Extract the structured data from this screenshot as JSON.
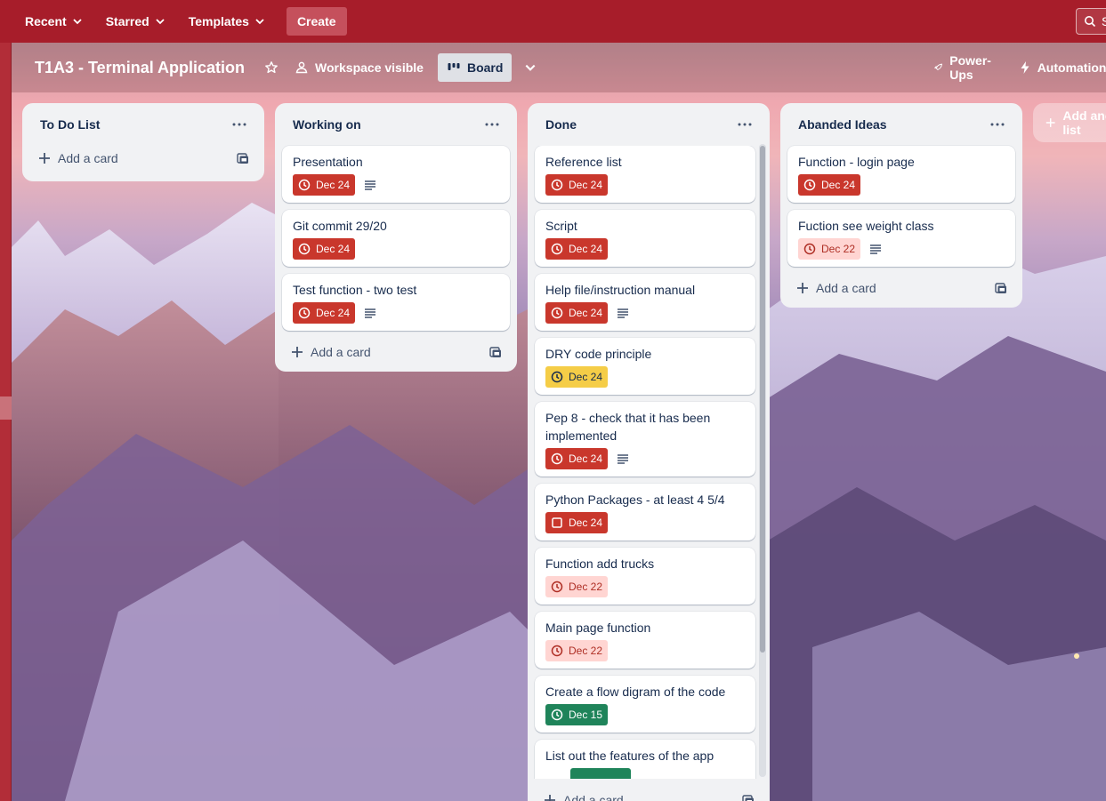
{
  "topnav": {
    "items": [
      {
        "label": "Recent"
      },
      {
        "label": "Starred"
      },
      {
        "label": "Templates"
      }
    ],
    "create_label": "Create",
    "search_placeholder": "S"
  },
  "board": {
    "title": "T1A3 - Terminal Application",
    "visibility_label": "Workspace visible",
    "view_label": "Board",
    "powerups_label": "Power-Ups",
    "automation_label": "Automation",
    "add_list_label": "Add another list"
  },
  "lists": [
    {
      "title": "To Do List",
      "add_card_label": "Add a card",
      "cards": []
    },
    {
      "title": "Working on",
      "add_card_label": "Add a card",
      "cards": [
        {
          "title": "Presentation",
          "due": "Dec 24",
          "due_status": "overdue",
          "has_description": true
        },
        {
          "title": "Git commit 29/20",
          "due": "Dec 24",
          "due_status": "overdue",
          "has_description": false
        },
        {
          "title": "Test function - two test",
          "due": "Dec 24",
          "due_status": "overdue",
          "has_description": true
        }
      ]
    },
    {
      "title": "Done",
      "add_card_label": "Add a card",
      "cards": [
        {
          "title": "Reference list",
          "due": "Dec 24",
          "due_status": "overdue",
          "has_description": false
        },
        {
          "title": "Script",
          "due": "Dec 24",
          "due_status": "overdue",
          "has_description": false
        },
        {
          "title": "Help file/instruction manual",
          "due": "Dec 24",
          "due_status": "overdue",
          "has_description": true
        },
        {
          "title": "DRY code principle",
          "due": "Dec 24",
          "due_status": "soon",
          "has_description": false
        },
        {
          "title": "Pep 8 - check that it has been implemented",
          "due": "Dec 24",
          "due_status": "overdue",
          "has_description": true
        },
        {
          "title": "Python Packages - at least 4 5/4",
          "due": "Dec 24",
          "due_status": "overdue-checkbox",
          "has_description": false
        },
        {
          "title": "Function add trucks",
          "due": "Dec 22",
          "due_status": "past",
          "has_description": false
        },
        {
          "title": "Main page function",
          "due": "Dec 22",
          "due_status": "past",
          "has_description": false
        },
        {
          "title": "Create a flow digram of the code",
          "due": "Dec 15",
          "due_status": "done",
          "has_description": false
        },
        {
          "title": "List out the features of the app",
          "due": "",
          "due_status": "done",
          "has_description": false
        }
      ]
    },
    {
      "title": "Abanded Ideas",
      "add_card_label": "Add a card",
      "cards": [
        {
          "title": "Function - login page",
          "due": "Dec 24",
          "due_status": "overdue",
          "has_description": false
        },
        {
          "title": "Fuction see weight class",
          "due": "Dec 22",
          "due_status": "past",
          "has_description": true
        }
      ]
    }
  ],
  "colors": {
    "nav_bg": "#a71d2a",
    "overdue": "#c9372c",
    "soon": "#f5cd47",
    "past": "#ffd5d2",
    "done": "#1f845a"
  }
}
